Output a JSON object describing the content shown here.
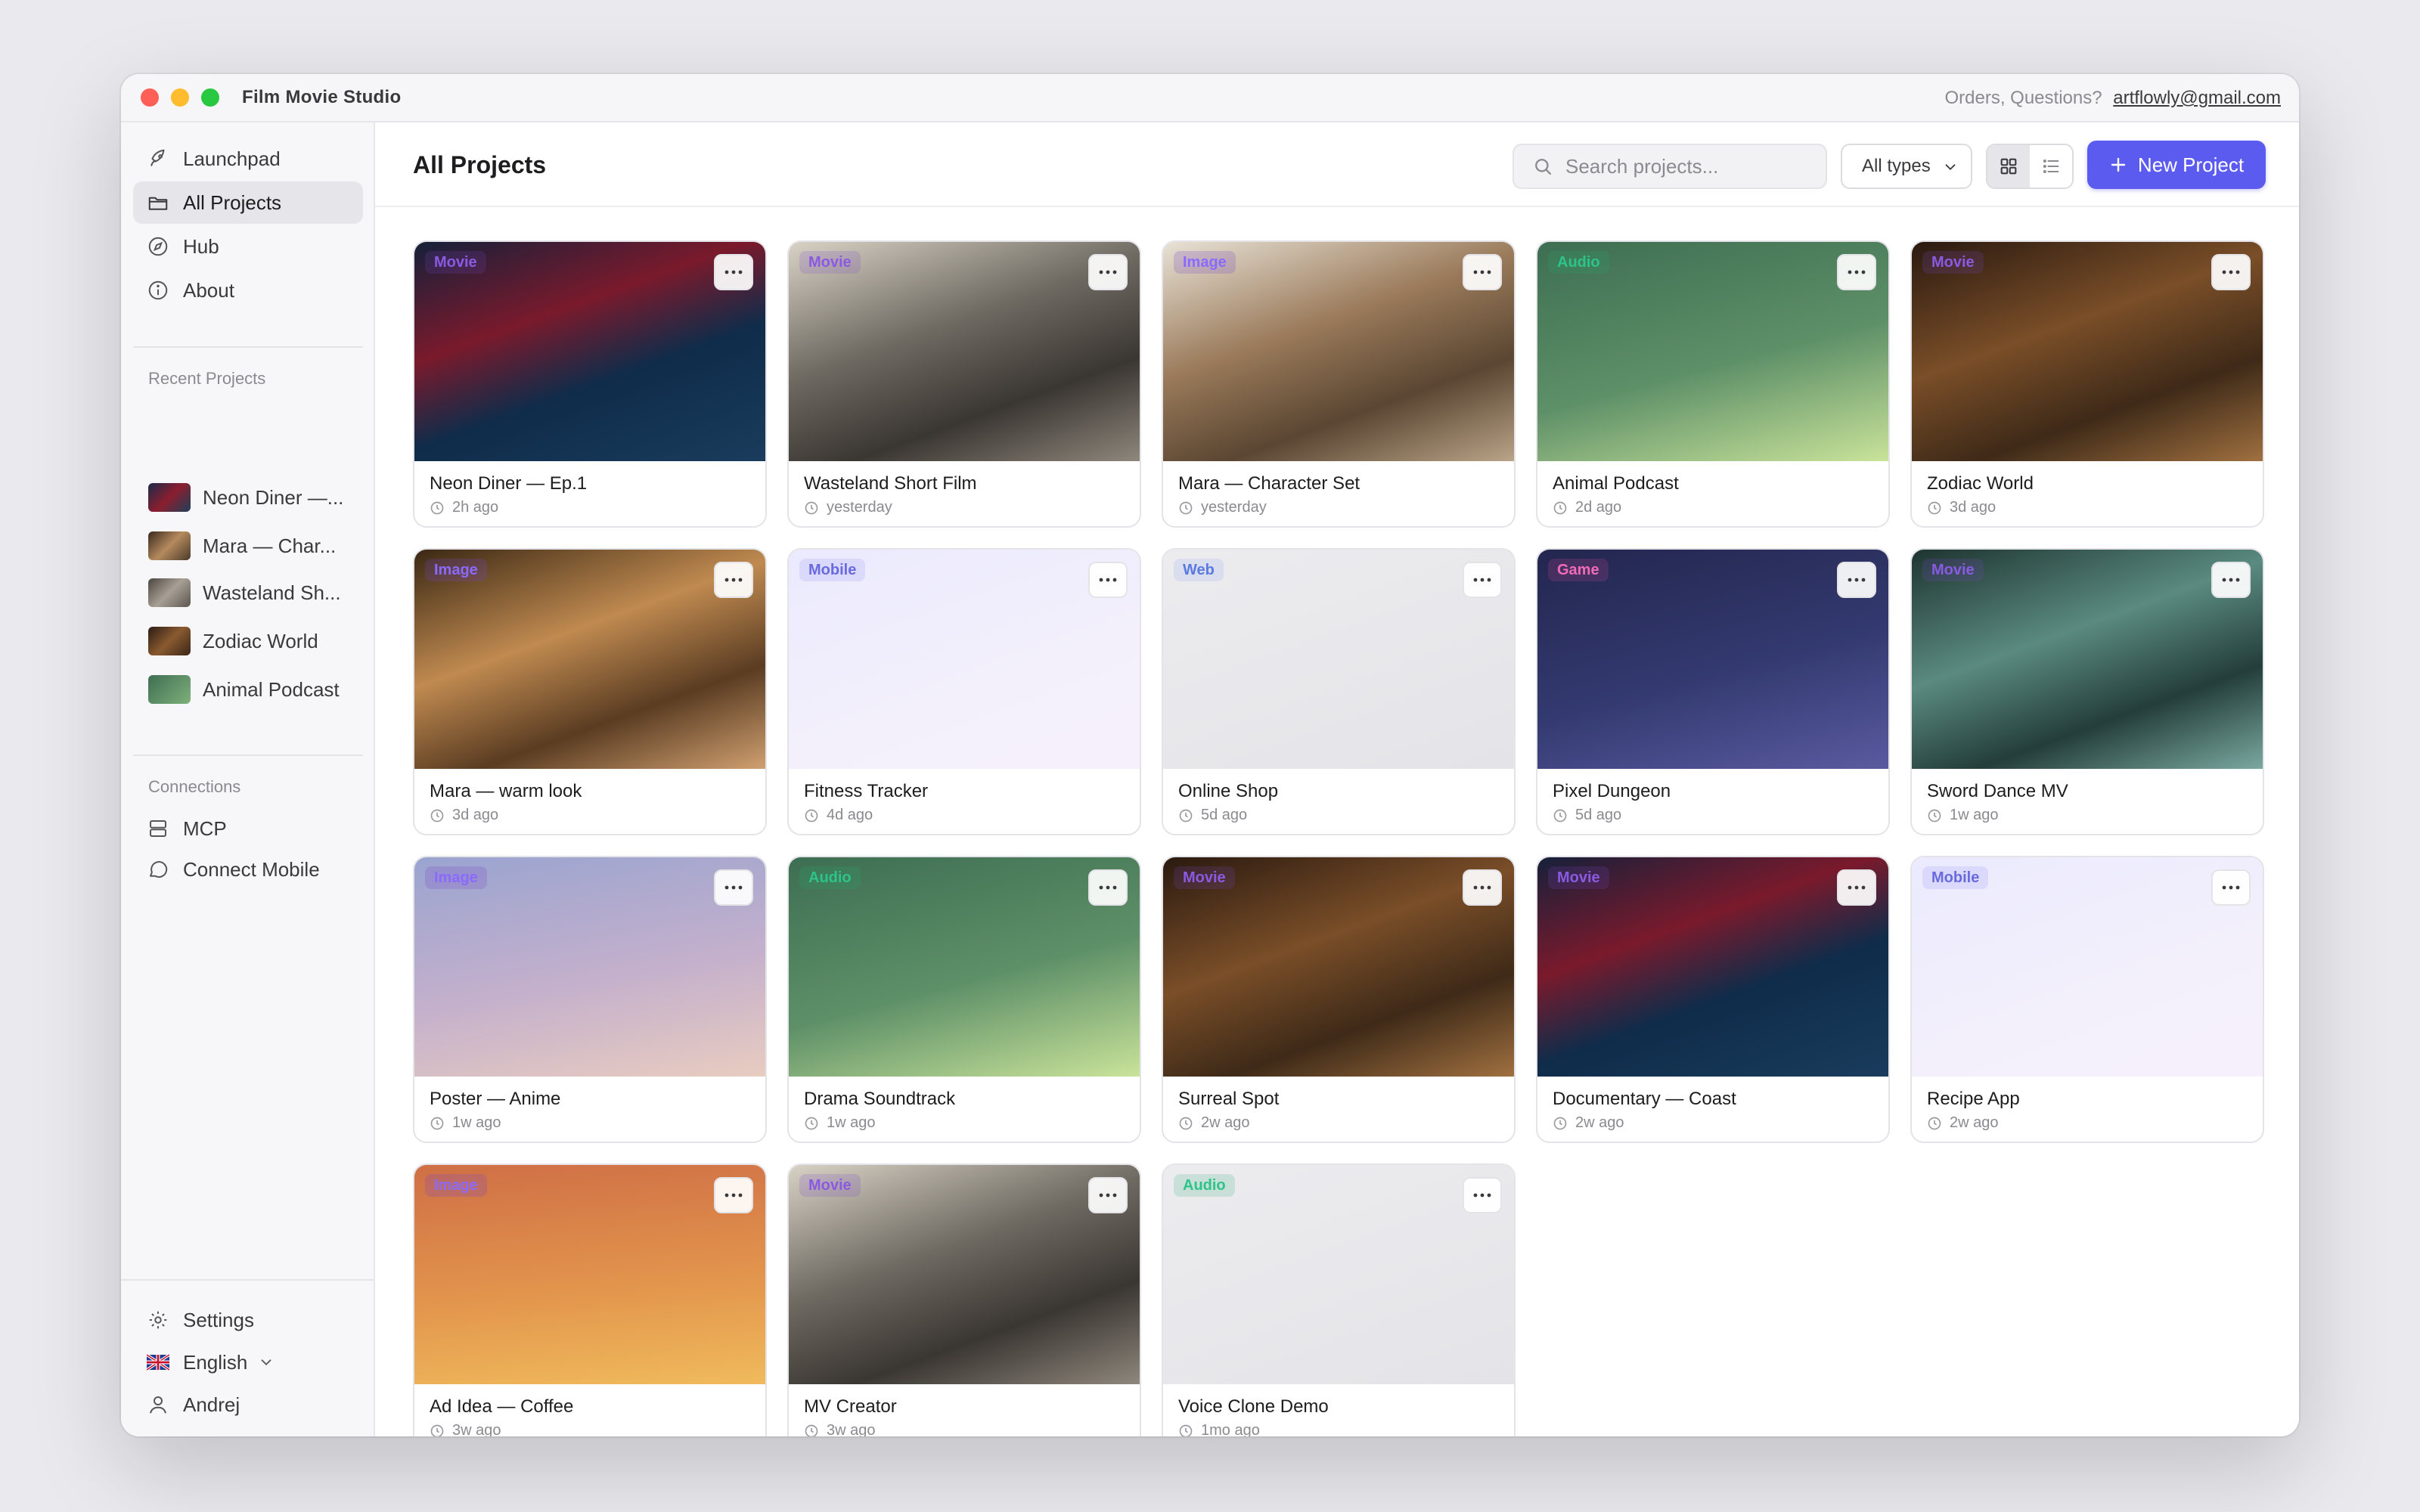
{
  "window": {
    "title": "Film Movie Studio",
    "support_text": "Orders, Questions?",
    "support_email": "artflowly@gmail.com"
  },
  "sidebar": {
    "nav": [
      {
        "label": "Launchpad",
        "icon": "rocket-icon"
      },
      {
        "label": "All Projects",
        "icon": "folder-icon",
        "active": true
      },
      {
        "label": "Hub",
        "icon": "compass-icon"
      },
      {
        "label": "About",
        "icon": "info-icon"
      }
    ],
    "recent_label": "Recent Projects",
    "recent": [
      {
        "label": "Neon Diner —..."
      },
      {
        "label": "Mara — Char..."
      },
      {
        "label": "Wasteland Sh..."
      },
      {
        "label": "Zodiac World"
      },
      {
        "label": "Animal Podcast"
      }
    ],
    "connections_label": "Connections",
    "connections": [
      {
        "label": "MCP",
        "icon": "server-icon"
      },
      {
        "label": "Connect Mobile",
        "icon": "chat-bubble-icon"
      }
    ],
    "footer": [
      {
        "label": "Settings",
        "icon": "gear-icon"
      },
      {
        "label": "English",
        "icon": "uk-flag-icon"
      },
      {
        "label": "Andrej",
        "icon": "user-icon"
      }
    ]
  },
  "toolbar": {
    "title": "All Projects",
    "search_placeholder": "Search projects...",
    "filter_value": "All types",
    "new_label": "New Project",
    "accent": "#5b5bf0"
  },
  "projects": [
    {
      "name": "Neon Diner — Ep.1",
      "time": "2h ago",
      "type": "Movie"
    },
    {
      "name": "Wasteland Short Film",
      "time": "yesterday",
      "type": "Movie"
    },
    {
      "name": "Mara — Character Set",
      "time": "yesterday",
      "type": "Image"
    },
    {
      "name": "Animal Podcast",
      "time": "2d ago",
      "type": "Audio"
    },
    {
      "name": "Zodiac World",
      "time": "3d ago",
      "type": "Movie"
    },
    {
      "name": "Mara — warm look",
      "time": "3d ago",
      "type": "Image"
    },
    {
      "name": "Fitness Tracker",
      "time": "4d ago",
      "type": "Mobile"
    },
    {
      "name": "Online Shop",
      "time": "5d ago",
      "type": "Web"
    },
    {
      "name": "Pixel Dungeon",
      "time": "5d ago",
      "type": "Game"
    },
    {
      "name": "Sword Dance MV",
      "time": "1w ago",
      "type": "Movie"
    },
    {
      "name": "Poster — Anime",
      "time": "1w ago",
      "type": "Image"
    },
    {
      "name": "Drama Soundtrack",
      "time": "1w ago",
      "type": "Audio"
    },
    {
      "name": "Surreal Spot",
      "time": "2w ago",
      "type": "Movie"
    },
    {
      "name": "Documentary — Coast",
      "time": "2w ago",
      "type": "Movie"
    },
    {
      "name": "Recipe App",
      "time": "2w ago",
      "type": "Mobile"
    },
    {
      "name": "Ad Idea — Coffee",
      "time": "3w ago",
      "type": "Image"
    },
    {
      "name": "MV Creator",
      "time": "3w ago",
      "type": "Movie"
    },
    {
      "name": "Voice Clone Demo",
      "time": "1mo ago",
      "type": "Audio"
    }
  ]
}
